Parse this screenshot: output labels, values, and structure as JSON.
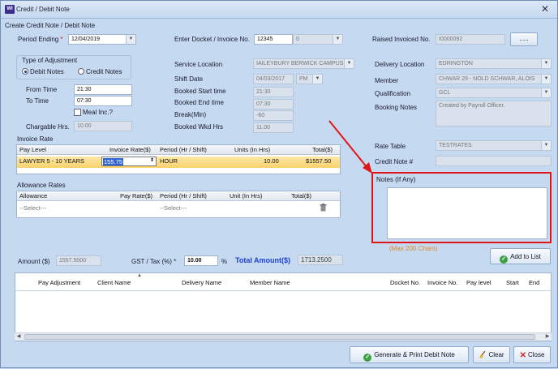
{
  "window": {
    "title": "Credit / Debit Note",
    "app_icon": "WI",
    "close_glyph": "✕"
  },
  "form_title": "Create Credit Note / Debit Note",
  "period": {
    "label": "Period Ending",
    "required": "*",
    "value": "12/04/2019"
  },
  "docket": {
    "label": "Enter Docket / Invoice No.",
    "value": "12345",
    "extra": "0"
  },
  "raised": {
    "label": "Raised Invoiced No.",
    "value": "I0000092",
    "button": "....."
  },
  "adjustment": {
    "title": "Type of Adjustment",
    "debit": "Debit Notes",
    "credit": "Credit Notes",
    "selected": "debit"
  },
  "from_time": {
    "label": "From Time",
    "value": "21:30"
  },
  "to_time": {
    "label": "To Time",
    "value": "07:30"
  },
  "meal": {
    "label": "Meal Inc.?"
  },
  "chargable": {
    "label": "Chargable Hrs.",
    "value": "10.00"
  },
  "service_location": {
    "label": "Service Location",
    "value": "IAILEYBURY BERWICK CAMPUS"
  },
  "shift_date": {
    "label": "Shift Date",
    "value": "04/03/2017",
    "ampm": "PM"
  },
  "booked_start": {
    "label": "Booked Start time",
    "value": "21:30"
  },
  "booked_end": {
    "label": "Booked End time",
    "value": "07:30"
  },
  "break": {
    "label": "Break(Min)",
    "value": "-60"
  },
  "booked_wkd": {
    "label": "Booked Wkd Hrs",
    "value": "11.00"
  },
  "delivery_location": {
    "label": "Delivery Location",
    "value": "EDRINGTON"
  },
  "member": {
    "label": "Member",
    "value": "CHWAR 29 - NOLD SCHWAR, ALOIS"
  },
  "qualification": {
    "label": "Qualification",
    "value": "GCL"
  },
  "booking_notes": {
    "label": "Booking Notes",
    "value": "Created by Payroll Officer."
  },
  "rate_table": {
    "label": "Rate Table",
    "value": "TESTRATES"
  },
  "credit_note_no": {
    "label": "Credit Note #",
    "value": ""
  },
  "notes": {
    "label": "Notes (If Any)",
    "hint": "(Max 200  Chars)"
  },
  "invoice_rate": {
    "section": "Invoice Rate",
    "columns": [
      "Pay Level",
      "Invoice Rate($)",
      "Period (Hr / Shift)",
      "Units (In Hrs)",
      "Total($)"
    ],
    "row": {
      "pay_level": "LAWYER 5 - 10 YEARS",
      "rate": "155.75",
      "period": "HOUR",
      "units": "10.00",
      "total": "$1557.50"
    }
  },
  "allowance": {
    "section": "Allowance Rates",
    "columns": [
      "Allowance",
      "Pay Rate($)",
      "Period (Hr / Shift)",
      "Unit (In Hrs)",
      "Total($)"
    ],
    "row": {
      "allowance": "--Select---",
      "period": "--Select---"
    }
  },
  "amount": {
    "label": "Amount ($)",
    "value": "1557.5000"
  },
  "gst": {
    "label": "GST / Tax (%) *",
    "value": "10.00",
    "unit": "%"
  },
  "total_amount": {
    "label": "Total Amount($)",
    "value": "1713.2500",
    "color": "#1f3fd4"
  },
  "add_to_list": "Add to List",
  "list": {
    "columns": [
      "Pay Adjustment",
      "Client Name",
      "Delivery Name",
      "Member Name",
      "Docket No.",
      "Invoice No.",
      "Pay level",
      "Start",
      "End"
    ]
  },
  "footer": {
    "generate": "Generate & Print Debit Note",
    "clear": "Clear",
    "close": "Close"
  },
  "colors": {
    "highlight": "#e01616",
    "accent": "#1f3fd4",
    "selected_row": "#fbd26c"
  }
}
